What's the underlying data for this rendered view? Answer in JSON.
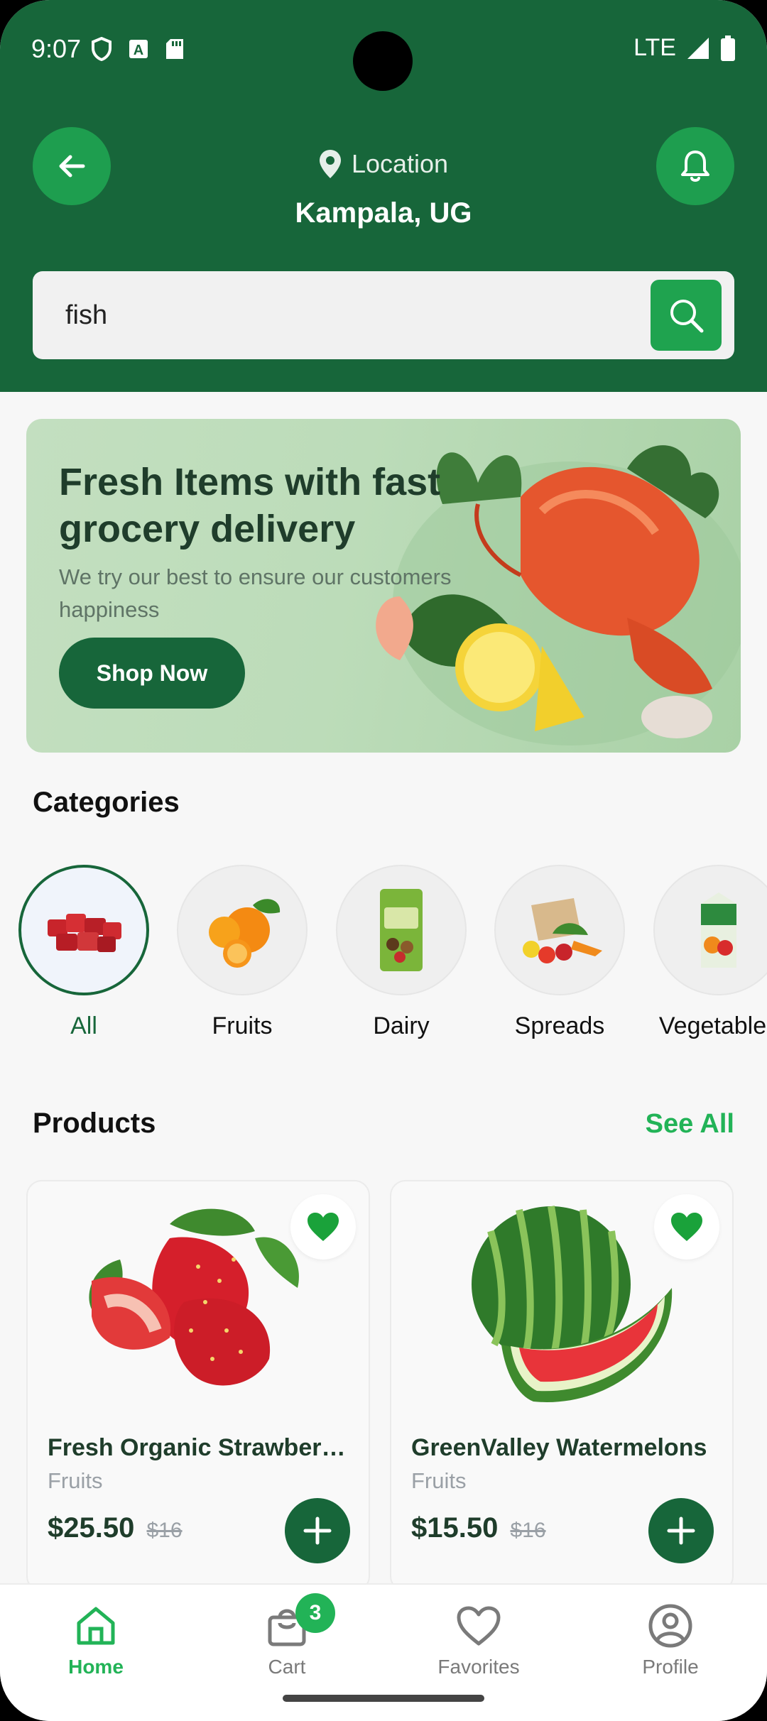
{
  "status_bar": {
    "time": "9:07",
    "network": "LTE"
  },
  "header": {
    "location_label": "Location",
    "location_value": "Kampala, UG",
    "search_value": "fish"
  },
  "banner": {
    "title": "Fresh Items with fast grocery delivery",
    "subtitle": "We try our best to ensure our customers happiness",
    "cta": "Shop Now"
  },
  "categories": {
    "title": "Categories",
    "items": [
      {
        "label": "All",
        "active": true
      },
      {
        "label": "Fruits"
      },
      {
        "label": "Dairy"
      },
      {
        "label": "Spreads"
      },
      {
        "label": "Vegetables"
      }
    ]
  },
  "products": {
    "title": "Products",
    "see_all": "See All",
    "items": [
      {
        "name": "Fresh Organic Strawberries",
        "category": "Fruits",
        "price": "$25.50",
        "old_price": "$16"
      },
      {
        "name": "GreenValley Watermelons",
        "category": "Fruits",
        "price": "$15.50",
        "old_price": "$16"
      }
    ]
  },
  "bottom_nav": {
    "items": [
      {
        "label": "Home",
        "active": true
      },
      {
        "label": "Cart",
        "badge": "3"
      },
      {
        "label": "Favorites"
      },
      {
        "label": "Profile"
      }
    ]
  },
  "colors": {
    "primary": "#17663a",
    "accent": "#22b357",
    "button": "#1e9e4f"
  }
}
